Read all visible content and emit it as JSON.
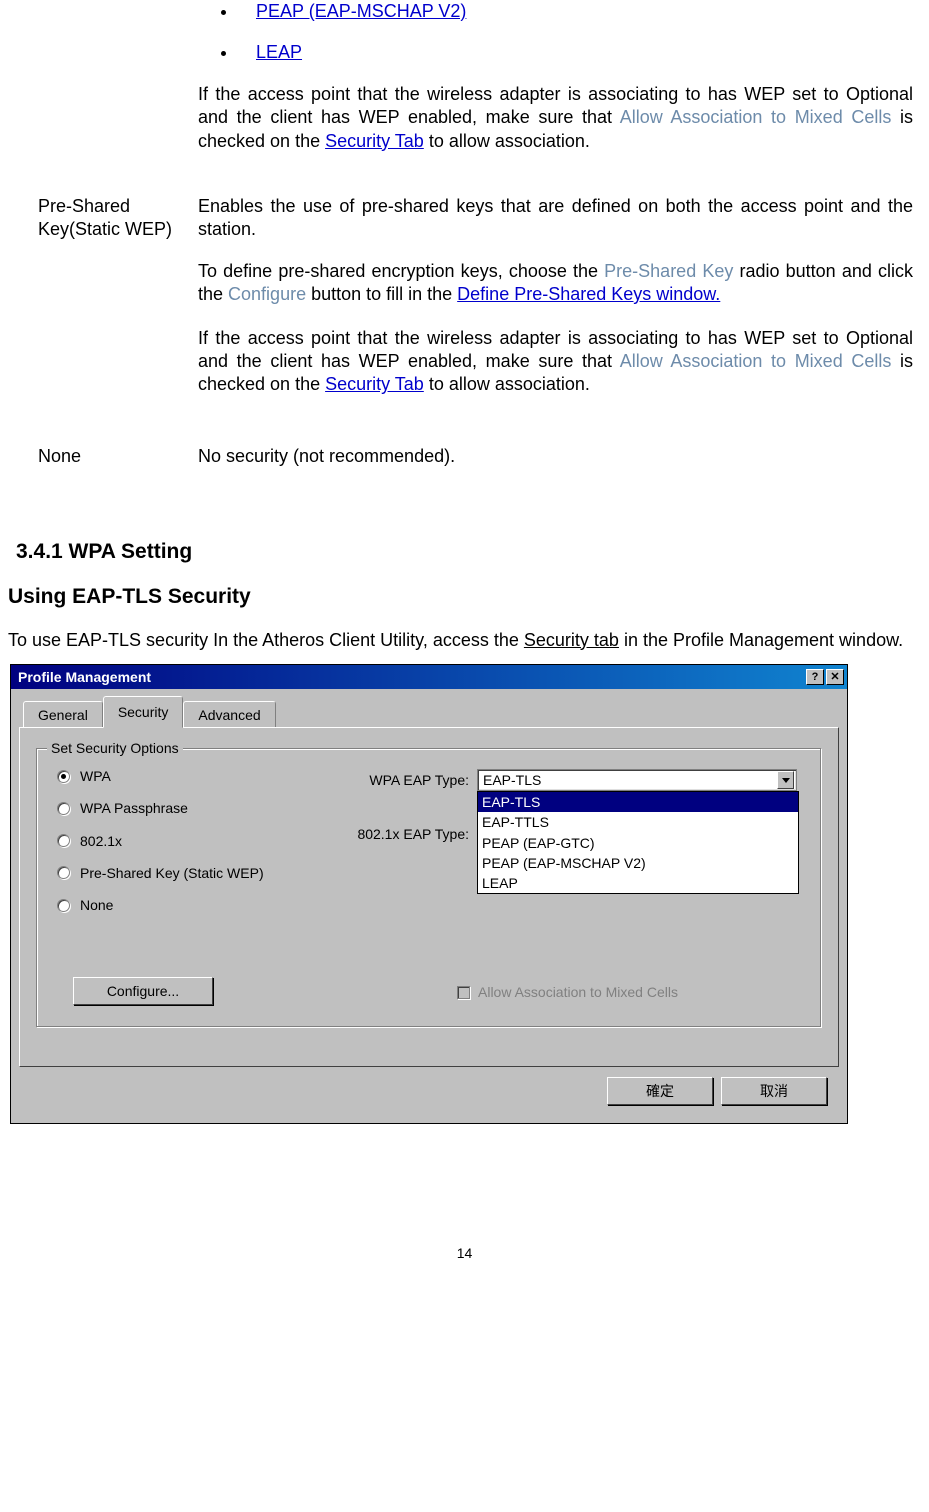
{
  "protocols": {
    "peap": "PEAP (EAP-MSCHAP V2)",
    "leap": "LEAP"
  },
  "rows": {
    "wpa_note": {
      "pre": "If the access point that the wireless adapter is associating to has WEP set to Optional and the client has WEP enabled, make sure that ",
      "allow": "Allow Association to Mixed Cells",
      "mid": " is checked on the ",
      "seclink": "Security Tab",
      "post": " to allow association."
    },
    "psk": {
      "label": "Pre-Shared Key(Static WEP)",
      "p1": "Enables the use of pre-shared keys that are defined on both the access point and the station.",
      "p2_pre": "To define pre-shared encryption keys, choose the ",
      "p2_psk": "Pre-Shared Key",
      "p2_mid": " radio button and click the ",
      "p2_conf": "Configure",
      "p2_mid2": " button to fill in the ",
      "p2_define": "Define Pre-Shared Keys window.",
      "note_pre": "If the access point that the wireless adapter is associating to has WEP set to Optional and the client has WEP enabled, make sure that ",
      "note_allow": "Allow Association to Mixed Cells",
      "note_mid": " is checked on the ",
      "note_seclink": "Security Tab",
      "note_post": " to allow association."
    },
    "none": {
      "label": "None",
      "desc": "No security (not recommended)."
    }
  },
  "headings": {
    "h341": "3.4.1  WPA Setting",
    "h_tls": "Using EAP-TLS Security"
  },
  "intro": {
    "pre": "To use EAP-TLS security In the Atheros Client Utility, access the ",
    "link": "Security tab",
    "post": " in the Profile Management window."
  },
  "dialog": {
    "title": "Profile Management",
    "help_glyph": "?",
    "close_glyph": "✕",
    "tabs": [
      "General",
      "Security",
      "Advanced"
    ],
    "group_title": "Set Security Options",
    "radios": [
      "WPA",
      "WPA Passphrase",
      "802.1x",
      "Pre-Shared Key (Static WEP)",
      "None"
    ],
    "labels": {
      "wpa_type": "WPA EAP Type:",
      "dot1x_type": "802.1x EAP Type:"
    },
    "combo_value": "EAP-TLS",
    "dropdown": [
      "EAP-TLS",
      "EAP-TTLS",
      "PEAP (EAP-GTC)",
      "PEAP (EAP-MSCHAP V2)",
      "LEAP"
    ],
    "configure_btn": "Configure...",
    "allow_mixed": "Allow Association to Mixed Cells",
    "ok_btn": "確定",
    "cancel_btn": "取消"
  },
  "page_num": "14"
}
